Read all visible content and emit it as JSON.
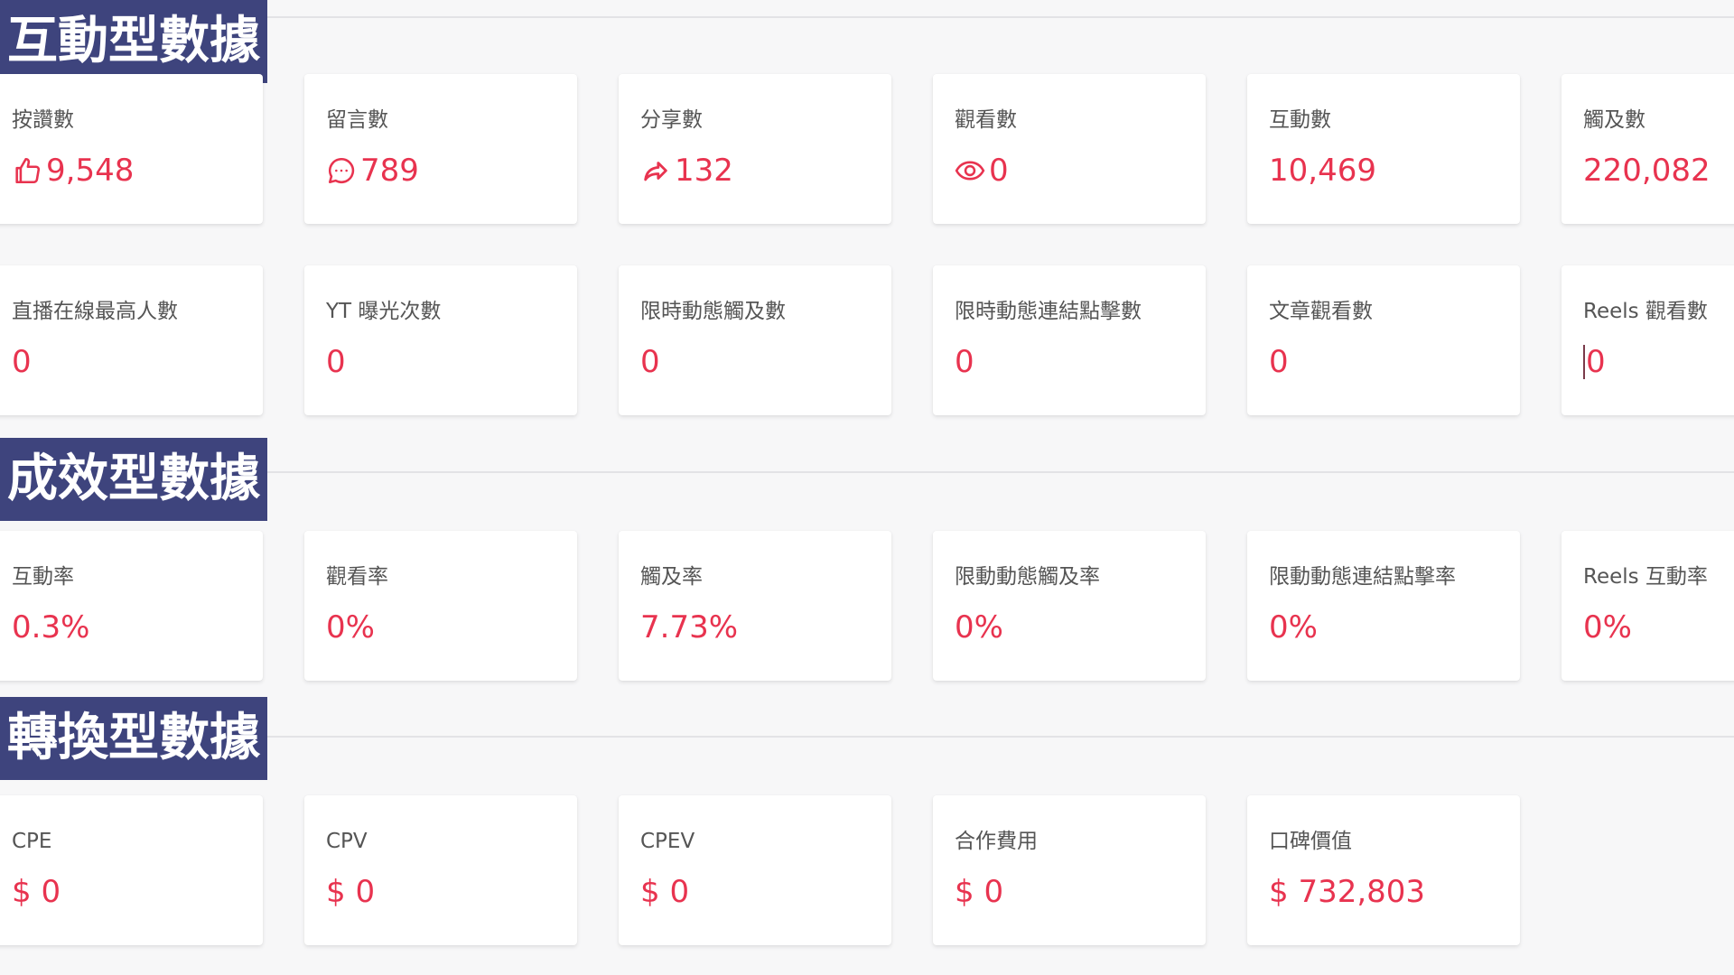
{
  "sections": {
    "engagement": {
      "title": "互動型數據",
      "cards": [
        {
          "label": "按讚數",
          "value": "9,548",
          "icon": "thumbs-up-icon"
        },
        {
          "label": "留言數",
          "value": "789",
          "icon": "comment-icon"
        },
        {
          "label": "分享數",
          "value": "132",
          "icon": "share-icon"
        },
        {
          "label": "觀看數",
          "value": "0",
          "icon": "eye-icon"
        },
        {
          "label": "互動數",
          "value": "10,469"
        },
        {
          "label": "觸及數",
          "value": "220,082"
        },
        {
          "label": "直播在線最高人數",
          "value": "0"
        },
        {
          "label": "YT 曝光次數",
          "value": "0"
        },
        {
          "label": "限時動態觸及數",
          "value": "0"
        },
        {
          "label": "限時動態連結點擊數",
          "value": "0"
        },
        {
          "label": "文章觀看數",
          "value": "0"
        },
        {
          "label": "Reels 觀看數",
          "value": "0"
        }
      ]
    },
    "performance": {
      "title": "成效型數據",
      "cards": [
        {
          "label": "互動率",
          "value": "0.3%"
        },
        {
          "label": "觀看率",
          "value": "0%"
        },
        {
          "label": "觸及率",
          "value": "7.73%"
        },
        {
          "label": "限動動態觸及率",
          "value": "0%"
        },
        {
          "label": "限動動態連結點擊率",
          "value": "0%"
        },
        {
          "label": "Reels 互動率",
          "value": "0%"
        }
      ]
    },
    "conversion": {
      "title": "轉換型數據",
      "cards": [
        {
          "label": "CPE",
          "value": "$ 0"
        },
        {
          "label": "CPV",
          "value": "$ 0"
        },
        {
          "label": "CPEV",
          "value": "$ 0"
        },
        {
          "label": "合作費用",
          "value": "$ 0"
        },
        {
          "label": "口碑價值",
          "value": "$ 732,803"
        }
      ]
    }
  },
  "colors": {
    "section_tag_bg": "#3e447d",
    "value_text": "#e8334f",
    "label_text": "#555555",
    "page_bg": "#f7f7f8"
  }
}
